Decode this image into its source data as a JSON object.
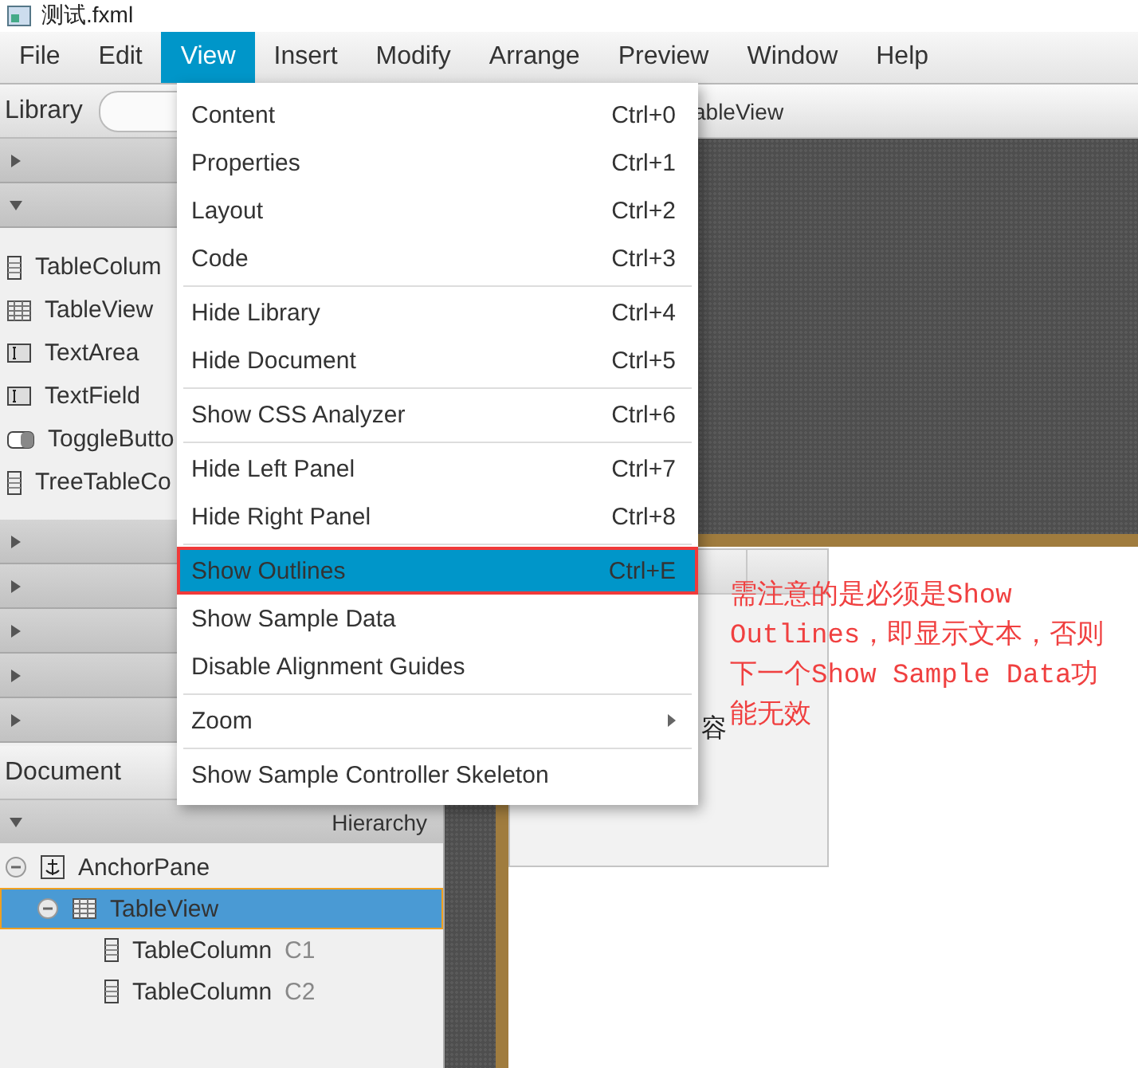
{
  "window": {
    "title": "测试.fxml"
  },
  "menu_bar": [
    {
      "label": "File",
      "selected": false
    },
    {
      "label": "Edit",
      "selected": false
    },
    {
      "label": "View",
      "selected": true
    },
    {
      "label": "Insert",
      "selected": false
    },
    {
      "label": "Modify",
      "selected": false
    },
    {
      "label": "Arrange",
      "selected": false
    },
    {
      "label": "Preview",
      "selected": false
    },
    {
      "label": "Window",
      "selected": false
    },
    {
      "label": "Help",
      "selected": false
    }
  ],
  "view_menu": [
    [
      {
        "label": "Content",
        "shortcut": "Ctrl+0",
        "selected": false
      },
      {
        "label": "Properties",
        "shortcut": "Ctrl+1",
        "selected": false
      },
      {
        "label": "Layout",
        "shortcut": "Ctrl+2",
        "selected": false
      },
      {
        "label": "Code",
        "shortcut": "Ctrl+3",
        "selected": false
      }
    ],
    [
      {
        "label": "Hide Library",
        "shortcut": "Ctrl+4",
        "selected": false
      },
      {
        "label": "Hide Document",
        "shortcut": "Ctrl+5",
        "selected": false
      }
    ],
    [
      {
        "label": "Show CSS Analyzer",
        "shortcut": "Ctrl+6",
        "selected": false
      }
    ],
    [
      {
        "label": "Hide Left Panel",
        "shortcut": "Ctrl+7",
        "selected": false
      },
      {
        "label": "Hide Right Panel",
        "shortcut": "Ctrl+8",
        "selected": false
      }
    ],
    [
      {
        "label": "Show Outlines",
        "shortcut": "Ctrl+E",
        "selected": true,
        "annotated": true
      },
      {
        "label": "Show Sample Data",
        "selected": false
      },
      {
        "label": "Disable Alignment Guides",
        "selected": false
      }
    ],
    [
      {
        "label": "Zoom",
        "submenu": true,
        "selected": false
      }
    ],
    [
      {
        "label": "Show Sample Controller Skeleton",
        "selected": false
      }
    ]
  ],
  "library": {
    "title": "Library",
    "sections": [
      {
        "expanded": false
      },
      {
        "expanded": true,
        "items": [
          {
            "label": "TableColum",
            "kind": "column"
          },
          {
            "label": "TableView",
            "kind": "table"
          },
          {
            "label": "TextArea",
            "kind": "text"
          },
          {
            "label": "TextField",
            "kind": "text"
          },
          {
            "label": "ToggleButto",
            "kind": "toggle"
          },
          {
            "label": "TreeTableCo",
            "kind": "column"
          }
        ]
      },
      {
        "expanded": false
      },
      {
        "expanded": false
      },
      {
        "expanded": false
      },
      {
        "expanded": false
      },
      {
        "expanded": false
      }
    ]
  },
  "document": {
    "title": "Document",
    "hierarchy": {
      "label": "Hierarchy",
      "expanded": true
    },
    "tree": [
      {
        "label": "AnchorPane",
        "kind": "anchor",
        "expanded": true,
        "selected": false,
        "children": [
          {
            "label": "TableView",
            "kind": "table",
            "expanded": true,
            "selected": true,
            "children": [
              {
                "label": "TableColumn",
                "id": "C1",
                "kind": "column",
                "selected": false
              },
              {
                "label": "TableColumn",
                "id": "C2",
                "kind": "column",
                "selected": false
              }
            ]
          }
        ]
      }
    ]
  },
  "canvas": {
    "breadcrumb": "ableView",
    "table_text": "容"
  },
  "annotation": {
    "text": "需注意的是必须是Show Outlines，即显示文本，否则下一个Show Sample Data功能无效"
  }
}
